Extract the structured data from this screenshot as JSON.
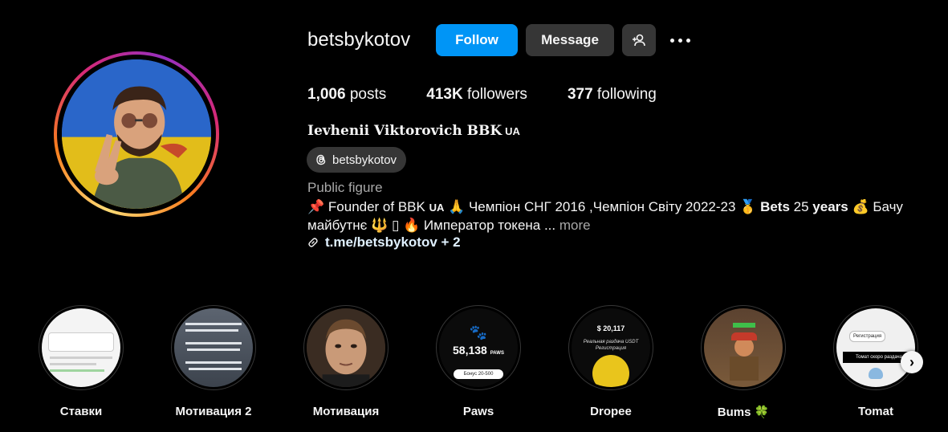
{
  "profile": {
    "username": "betsbykotov",
    "follow_label": "Follow",
    "message_label": "Message",
    "posts_count": "1,006",
    "posts_label": "posts",
    "followers_count": "413K",
    "followers_label": "followers",
    "following_count": "377",
    "following_label": "following",
    "full_name": "Ievhenii Viktorovich BBK",
    "name_flag": "UA",
    "threads_handle": "betsbykotov",
    "category": "Public figure",
    "bio_pin": "📌",
    "bio_part1": " Founder of BBK ",
    "bio_flag": "UA",
    "bio_part2": " 🙏  Чемпіон СНГ 2016 ,Чемпіон Світу 2022-23 🥇 ",
    "bio_bets": "Bets",
    "bio_25": " 25 ",
    "bio_years": "years",
    "bio_part3": " 💰 Бачу майбутнє 🔱 ▯ 🔥 Император токена ...",
    "bio_more": " more",
    "link_text": "t.me/betsbykotov + 2"
  },
  "highlights": [
    {
      "label": "Ставки"
    },
    {
      "label": "Мотивация 2"
    },
    {
      "label": "Мотивация"
    },
    {
      "label": "Paws",
      "text_count": "58,138",
      "text_unit": "PAWS",
      "text_bonus": "Бонус 20-500"
    },
    {
      "label": "Dropee",
      "text_amount": "20,117",
      "text_caption": "Реальная раздача USDT Регистрация"
    },
    {
      "label": "Bums 🍀"
    },
    {
      "label": "Tomat",
      "text_reg": "Регистрация",
      "text_soon": "Томат скоро раздача"
    }
  ],
  "icons": {
    "add_user": "add-user-icon",
    "more": "more-options-icon",
    "threads": "threads-icon",
    "link": "link-icon",
    "next": "chevron-right-icon"
  },
  "colors": {
    "follow": "#0095f6",
    "secondary_button": "#363636",
    "muted_text": "#a8a8a8",
    "background": "#000000"
  }
}
